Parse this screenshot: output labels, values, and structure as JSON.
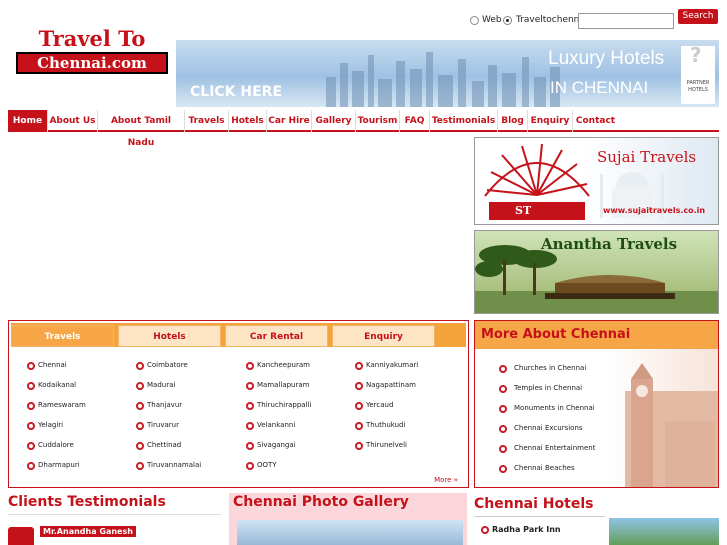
{
  "search": {
    "option_web": "Web",
    "option_site": "Traveltochennai",
    "button": "Search",
    "query": ""
  },
  "logo": {
    "line1": "Travel To",
    "line2": "Chennai.com"
  },
  "banner": {
    "cta": "CLICK HERE",
    "headline": "Luxury Hotels",
    "sub": "IN CHENNAI",
    "partner": "PARTNER HOTELS"
  },
  "nav": [
    "Home",
    "About Us",
    "About Tamil Nadu",
    "Travels",
    "Hotels",
    "Car Hire",
    "Gallery",
    "Tourism",
    "FAQ",
    "Testimonials",
    "Blog",
    "Enquiry",
    "Contact"
  ],
  "ads": {
    "ad1_title": "Sujai Travels",
    "ad1_url": "www.sujaitravels.co.in",
    "ad1_mark": "ST",
    "ad2_title": "Anantha Travels"
  },
  "tabs": [
    "Travels",
    "Hotels",
    "Car Rental",
    "Enquiry"
  ],
  "destinations": [
    [
      "Chennai",
      "Coimbatore",
      "Kancheepuram",
      "Kanniyakumari"
    ],
    [
      "Kodaikanal",
      "Madurai",
      "Mamallapuram",
      "Nagapattinam"
    ],
    [
      "Rameswaram",
      "Thanjavur",
      "Thiruchirappalli",
      "Yercaud"
    ],
    [
      "Yelagiri",
      "Tiruvarur",
      "Velankanni",
      "Thuthukudi"
    ],
    [
      "Cuddalore",
      "Chettinad",
      "Sivagangai",
      "Thirunelveli"
    ],
    [
      "Dharmapuri",
      "Tiruvannamalai",
      "OOTY",
      ""
    ]
  ],
  "more_link": "More »",
  "more_about": {
    "title": "More About Chennai",
    "items": [
      "Churches in Chennai",
      "Temples in Chennai",
      "Monuments in Chennai",
      "Chennai Excursions",
      "Chennai Entertainment",
      "Chennai Beaches"
    ]
  },
  "testimonials": {
    "title": "Clients Testimonials",
    "name": "Mr.Anandha Ganesh"
  },
  "gallery": {
    "title": "Chennai Photo Gallery"
  },
  "hotels": {
    "title": "Chennai Hotels",
    "first": "Radha Park Inn"
  }
}
